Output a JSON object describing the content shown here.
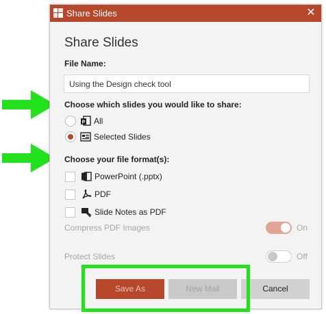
{
  "dialog": {
    "window_title": "Share Slides",
    "close_glyph": "✕",
    "heading": "Share Slides",
    "file_name_label": "File Name:",
    "file_name_value": "Using the Design check tool",
    "slides_question": "Choose which slides you would like to share:",
    "slide_options": [
      {
        "label": "All",
        "checked": false,
        "icon": "presentation-icon"
      },
      {
        "label": "Selected Slides",
        "checked": true,
        "icon": "slides-list-icon"
      }
    ],
    "format_question": "Choose your file format(s):",
    "formats": [
      {
        "label": "PowerPoint (.pptx)",
        "checked": false,
        "icon": "powerpoint-icon"
      },
      {
        "label": "PDF",
        "checked": false,
        "icon": "pdf-icon"
      },
      {
        "label": "Slide Notes as PDF",
        "checked": false,
        "icon": "slide-notes-icon"
      }
    ],
    "compress": {
      "label": "Compress PDF Images",
      "state": "On"
    },
    "protect": {
      "label": "Protect Slides",
      "state": "Off"
    },
    "buttons": {
      "save_as": "Save As",
      "new_mail": "New Mail",
      "cancel": "Cancel"
    }
  },
  "colors": {
    "accent": "#b7472a",
    "highlight": "#22e21b"
  }
}
